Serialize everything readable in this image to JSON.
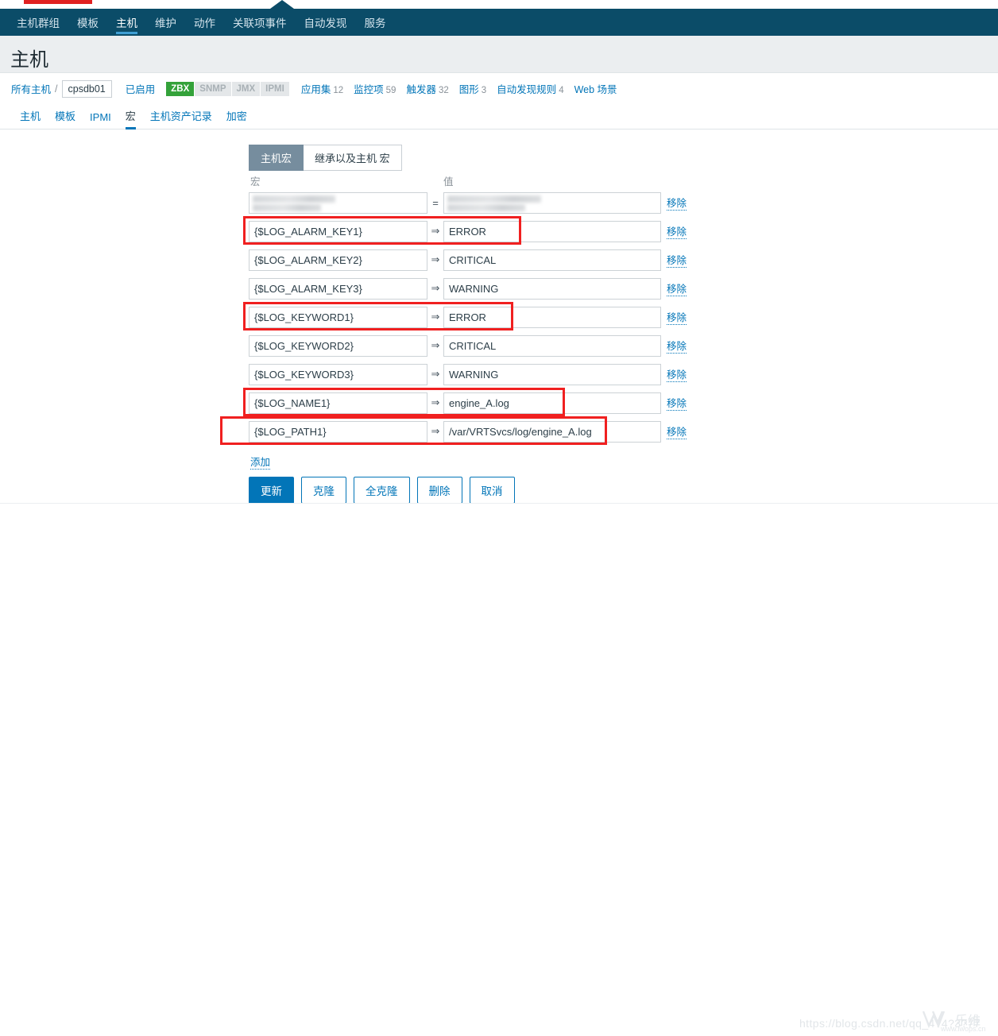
{
  "topbar": {
    "red_marker": "",
    "notch": ""
  },
  "nav": {
    "items": [
      {
        "label": "主机群组",
        "active": false
      },
      {
        "label": "模板",
        "active": false
      },
      {
        "label": "主机",
        "active": true
      },
      {
        "label": "维护",
        "active": false
      },
      {
        "label": "动作",
        "active": false
      },
      {
        "label": "关联项事件",
        "active": false
      },
      {
        "label": "自动发现",
        "active": false
      },
      {
        "label": "服务",
        "active": false
      }
    ]
  },
  "page": {
    "title": "主机"
  },
  "breadcrumb": {
    "all_hosts": "所有主机",
    "separator": "/",
    "host_name": "cpsdb01",
    "status": "已启用",
    "interfaces": [
      {
        "label": "ZBX",
        "enabled": true
      },
      {
        "label": "SNMP",
        "enabled": false
      },
      {
        "label": "JMX",
        "enabled": false
      },
      {
        "label": "IPMI",
        "enabled": false
      }
    ],
    "links": [
      {
        "label": "应用集",
        "count": "12"
      },
      {
        "label": "监控项",
        "count": "59"
      },
      {
        "label": "触发器",
        "count": "32"
      },
      {
        "label": "图形",
        "count": "3"
      },
      {
        "label": "自动发现规则",
        "count": "4"
      },
      {
        "label": "Web 场景",
        "count": ""
      }
    ]
  },
  "object_tabs": [
    {
      "label": "主机",
      "active": false
    },
    {
      "label": "模板",
      "active": false
    },
    {
      "label": "IPMI",
      "active": false
    },
    {
      "label": "宏",
      "active": true
    },
    {
      "label": "主机资产记录",
      "active": false
    },
    {
      "label": "加密",
      "active": false
    }
  ],
  "macro_tabs": [
    {
      "label": "主机宏",
      "active": true
    },
    {
      "label": "继承以及主机 宏",
      "active": false
    }
  ],
  "columns": {
    "macro": "宏",
    "value": "值"
  },
  "rows": [
    {
      "macro": "",
      "value": "",
      "operator": "=",
      "remove": "移除",
      "redacted": true,
      "highlighted": false
    },
    {
      "macro": "{$LOG_ALARM_KEY1}",
      "value": "ERROR",
      "operator": "⇒",
      "remove": "移除",
      "redacted": false,
      "highlighted": true
    },
    {
      "macro": "{$LOG_ALARM_KEY2}",
      "value": "CRITICAL",
      "operator": "⇒",
      "remove": "移除",
      "redacted": false,
      "highlighted": false
    },
    {
      "macro": "{$LOG_ALARM_KEY3}",
      "value": "WARNING",
      "operator": "⇒",
      "remove": "移除",
      "redacted": false,
      "highlighted": false
    },
    {
      "macro": "{$LOG_KEYWORD1}",
      "value": "ERROR",
      "operator": "⇒",
      "remove": "移除",
      "redacted": false,
      "highlighted": true
    },
    {
      "macro": "{$LOG_KEYWORD2}",
      "value": "CRITICAL",
      "operator": "⇒",
      "remove": "移除",
      "redacted": false,
      "highlighted": false
    },
    {
      "macro": "{$LOG_KEYWORD3}",
      "value": "WARNING",
      "operator": "⇒",
      "remove": "移除",
      "redacted": false,
      "highlighted": false
    },
    {
      "macro": "{$LOG_NAME1}",
      "value": "engine_A.log",
      "operator": "⇒",
      "remove": "移除",
      "redacted": false,
      "highlighted": true
    },
    {
      "macro": "{$LOG_PATH1}",
      "value": "/var/VRTSvcs/log/engine_A.log",
      "operator": "⇒",
      "remove": "移除",
      "redacted": false,
      "highlighted": true
    }
  ],
  "add_link": "添加",
  "buttons": [
    {
      "label": "更新",
      "primary": true
    },
    {
      "label": "克隆",
      "primary": false
    },
    {
      "label": "全克隆",
      "primary": false
    },
    {
      "label": "删除",
      "primary": false
    },
    {
      "label": "取消",
      "primary": false
    }
  ],
  "watermark": {
    "url": "https://blog.csdn.net/qq_4?4?3?77",
    "logo_text": "乐维",
    "logo_sub": "www.lwops.cn"
  },
  "colors": {
    "nav_bg": "#0b4c68",
    "accent_blue": "#0275b8",
    "active_underline": "#3f9fd4",
    "highlight_red": "#f02020",
    "badge_green": "#34a23a",
    "tab_active_bg": "#768d9e",
    "header_bg": "#ebeef0",
    "top_red": "#e02020"
  }
}
